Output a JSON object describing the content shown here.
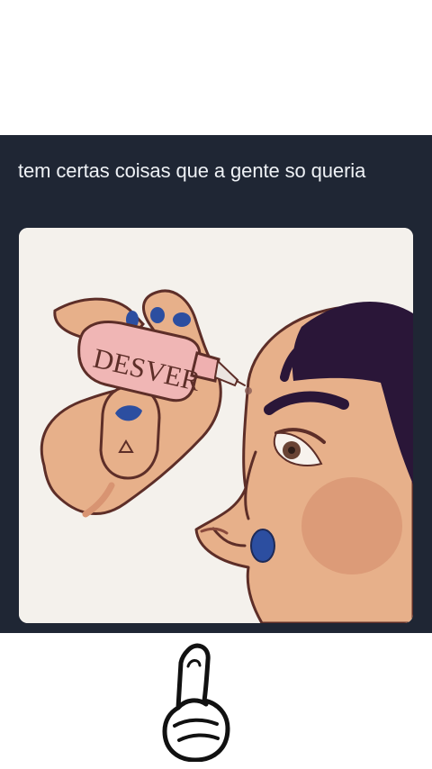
{
  "post": {
    "caption": "tem certas coisas que a gente so queria",
    "illustration": {
      "bottle_label": "DESVER",
      "colors": {
        "background": "#f4f1ec",
        "skin": "#e7b08a",
        "skin_shadow": "#d89472",
        "hair": "#2a1638",
        "nail": "#2c4ea0",
        "bottle": "#f0b6b5",
        "outline": "#5d2e28"
      }
    }
  },
  "theme": {
    "card_background": "#1f2634",
    "caption_color": "#eef1f5",
    "page_background": "#ffffff"
  },
  "sticker": {
    "icon": "pointing-up-hand-icon"
  }
}
